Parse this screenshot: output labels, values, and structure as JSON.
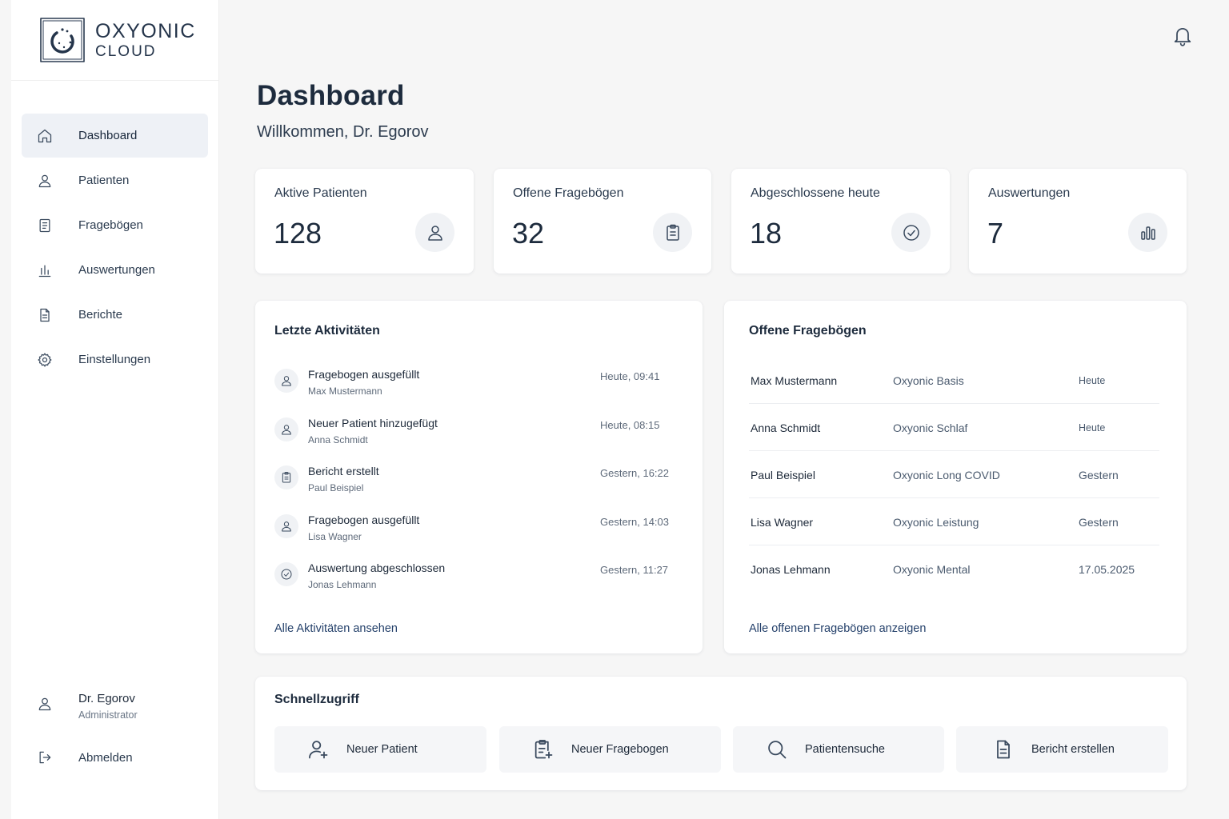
{
  "brand": {
    "line1": "OXYONIC",
    "line2": "CLOUD",
    "logo_icon": "oxyonic-logo-icon"
  },
  "sidebar": {
    "items": [
      {
        "label": "Dashboard",
        "icon": "home-icon",
        "active": true
      },
      {
        "label": "Patienten",
        "icon": "user-icon"
      },
      {
        "label": "Fragebögen",
        "icon": "document-icon"
      },
      {
        "label": "Auswertungen",
        "icon": "bar-chart-icon"
      },
      {
        "label": "Berichte",
        "icon": "file-text-icon"
      },
      {
        "label": "Einstellungen",
        "icon": "gear-icon"
      }
    ],
    "user": {
      "name": "Dr. Egorov",
      "role": "Administrator",
      "icon": "user-icon"
    },
    "logout": {
      "label": "Abmelden",
      "icon": "logout-icon"
    }
  },
  "header": {
    "title": "Dashboard",
    "welcome": "Willkommen, Dr. Egorov",
    "bell_icon": "bell-icon"
  },
  "stats": [
    {
      "label": "Aktive Patienten",
      "value": "128",
      "icon": "user-icon"
    },
    {
      "label": "Offene Fragebögen",
      "value": "32",
      "icon": "clipboard-icon"
    },
    {
      "label": "Abgeschlossene heute",
      "value": "18",
      "icon": "check-circle-icon"
    },
    {
      "label": "Auswertungen",
      "value": "7",
      "icon": "bar-chart-icon"
    }
  ],
  "activities": {
    "title": "Letzte Aktivitäten",
    "items": [
      {
        "title": "Fragebogen ausgefüllt",
        "sub": "Max Mustermann",
        "time": "Heute, 09:41",
        "icon": "user-icon"
      },
      {
        "title": "Neuer Patient hinzugefügt",
        "sub": "Anna Schmidt",
        "time": "Heute, 08:15",
        "icon": "user-icon"
      },
      {
        "title": "Bericht erstellt",
        "sub": "Paul Beispiel",
        "time": "Gestern, 16:22",
        "icon": "clipboard-icon"
      },
      {
        "title": "Fragebogen ausgefüllt",
        "sub": "Lisa Wagner",
        "time": "Gestern, 14:03",
        "icon": "user-icon"
      },
      {
        "title": "Auswertung abgeschlossen",
        "sub": "Jonas Lehmann",
        "time": "Gestern, 11:27",
        "icon": "check-circle-icon"
      }
    ],
    "link": "Alle Aktivitäten ansehen"
  },
  "open_questionnaires": {
    "title": "Offene Fragebögen",
    "rows": [
      {
        "name": "Max Mustermann",
        "type": "Oxyonic Basis",
        "date": "Heute"
      },
      {
        "name": "Anna Schmidt",
        "type": "Oxyonic Schlaf",
        "date": "Heute"
      },
      {
        "name": "Paul Beispiel",
        "type": "Oxyonic Long COVID",
        "date": "Gestern"
      },
      {
        "name": "Lisa Wagner",
        "type": "Oxyonic Leistung",
        "date": "Gestern"
      },
      {
        "name": "Jonas Lehmann",
        "type": "Oxyonic Mental",
        "date": "17.05.2025"
      }
    ],
    "link": "Alle offenen Fragebögen anzeigen"
  },
  "quick_access": {
    "title": "Schnellzugriff",
    "buttons": [
      {
        "label": "Neuer Patient",
        "icon": "user-plus-icon"
      },
      {
        "label": "Neuer Fragebogen",
        "icon": "clipboard-plus-icon"
      },
      {
        "label": "Patientensuche",
        "icon": "search-icon"
      },
      {
        "label": "Bericht erstellen",
        "icon": "file-text-icon"
      }
    ]
  },
  "colors": {
    "background": "#f6f6f6",
    "card": "#ffffff",
    "text": "#1d2b3d",
    "active_nav": "#eef1f6",
    "link": "#24406a"
  }
}
